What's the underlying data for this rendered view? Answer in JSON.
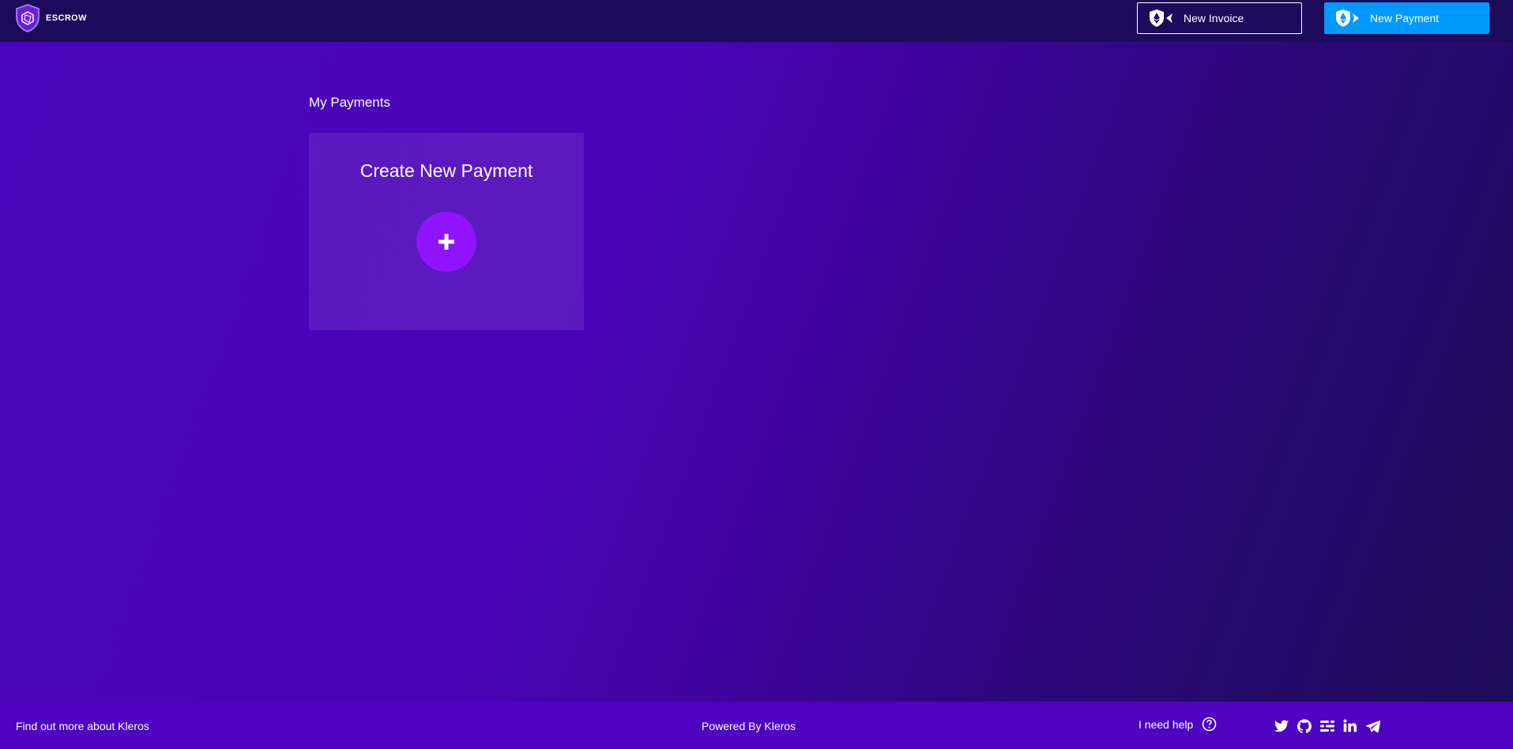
{
  "header": {
    "logo_text": "ESCROW",
    "new_invoice_label": "New Invoice",
    "new_payment_label": "New Payment"
  },
  "main": {
    "section_title": "My Payments",
    "create_card": {
      "title": "Create New Payment",
      "icon": "plus-icon"
    }
  },
  "footer": {
    "left_link": "Find out more about Kleros",
    "center_text": "Powered By Kleros",
    "help_label": "I need help",
    "social_icons": [
      "twitter-icon",
      "github-icon",
      "blog-icon",
      "linkedin-icon",
      "telegram-icon"
    ]
  },
  "colors": {
    "header_bg": "#1c0b5a",
    "accent_blue": "#009aff",
    "plus_purple": "#9013fe",
    "footer_bg": "#4d03c0"
  }
}
